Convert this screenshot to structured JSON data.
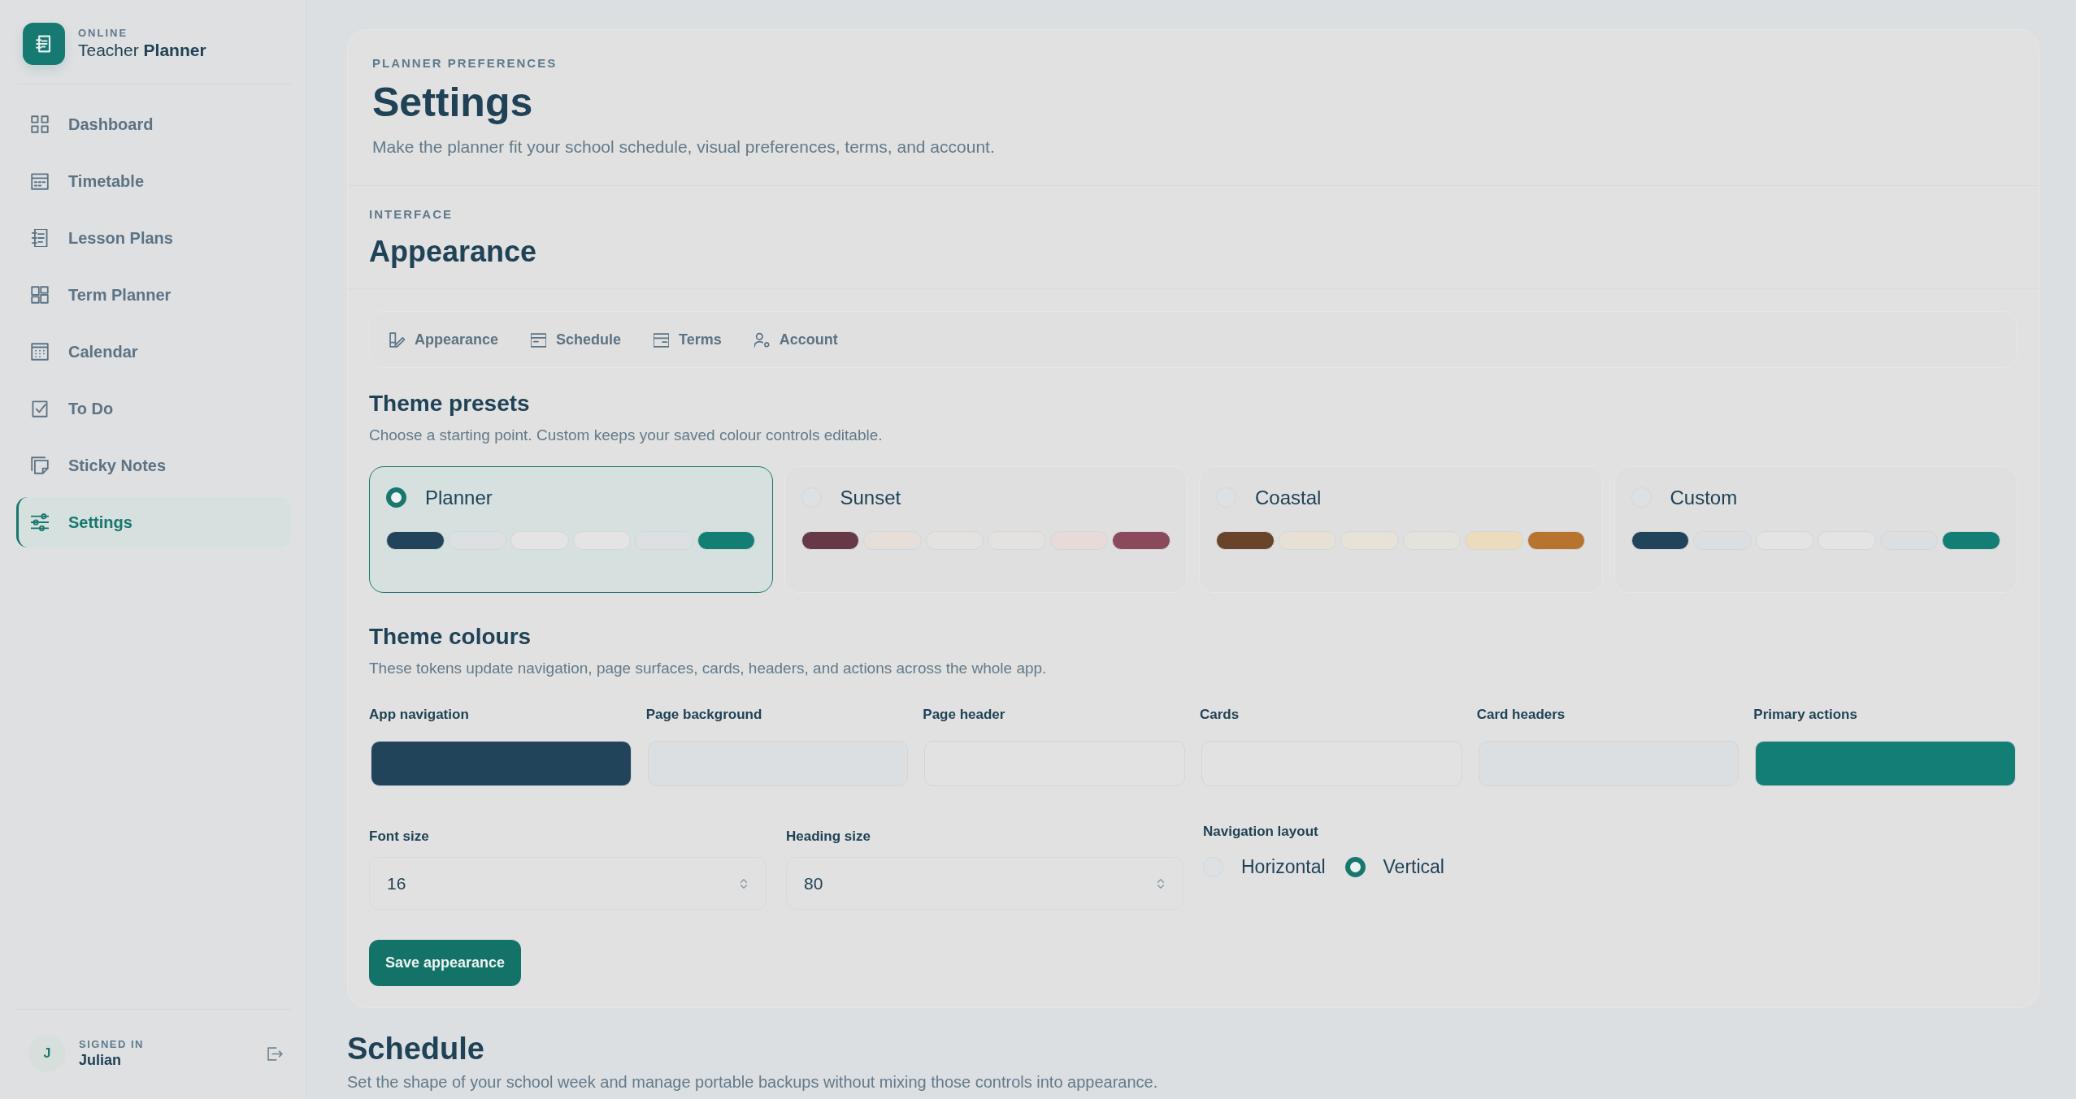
{
  "sidebar": {
    "brand": {
      "eyebrow": "ONLINE",
      "name": "Teacher **Planner**"
    },
    "nav": [
      {
        "label": "Dashboard",
        "selected": false
      },
      {
        "label": "Timetable",
        "selected": false
      },
      {
        "label": "Lesson Plans",
        "selected": false
      },
      {
        "label": "Term Planner",
        "selected": false
      },
      {
        "label": "Calendar",
        "selected": false
      },
      {
        "label": "To Do",
        "selected": false
      },
      {
        "label": "Sticky Notes",
        "selected": false
      },
      {
        "label": "Settings",
        "selected": true
      }
    ],
    "user": {
      "initial": "J",
      "caption": "SIGNED IN",
      "name": "Julian"
    }
  },
  "page_header": {
    "eyebrow": "PLANNER PREFERENCES",
    "title": "Settings",
    "subtitle": "Make the planner fit your school schedule, visual preferences, terms, and account."
  },
  "section": {
    "eyebrow": "INTERFACE",
    "title": "Appearance"
  },
  "tabs": [
    {
      "label": "Appearance"
    },
    {
      "label": "Schedule"
    },
    {
      "label": "Terms"
    },
    {
      "label": "Account"
    }
  ],
  "theme_presets": {
    "title": "Theme presets",
    "description": "Choose a starting point. Custom keeps your saved colour controls editable.",
    "presets": [
      {
        "name": "Planner",
        "selected": true,
        "swatches": [
          {
            "color": "#21445a"
          },
          {
            "color": "#dce0e3"
          },
          {
            "color": "#e4e4e4"
          },
          {
            "color": "#e4e4e4"
          },
          {
            "color": "#dce0e3"
          },
          {
            "color": "#137f74"
          }
        ]
      },
      {
        "name": "Sunset",
        "selected": false,
        "swatches": [
          {
            "color": "#673846"
          },
          {
            "color": "#e5ded9"
          },
          {
            "color": "#e3e2e0"
          },
          {
            "color": "#e3e2e0"
          },
          {
            "color": "#e6dbd9"
          },
          {
            "color": "#8b4a5c"
          }
        ]
      },
      {
        "name": "Coastal",
        "selected": false,
        "swatches": [
          {
            "color": "#6a4428"
          },
          {
            "color": "#e7e1d5"
          },
          {
            "color": "#e7e2d7"
          },
          {
            "color": "#e4e2dd"
          },
          {
            "color": "#ecdcbd"
          },
          {
            "color": "#b6742f"
          }
        ]
      },
      {
        "name": "Custom",
        "selected": false,
        "swatches": [
          {
            "color": "#21445a"
          },
          {
            "color": "#dbdfe1"
          },
          {
            "color": "#e4e4e4"
          },
          {
            "color": "#e4e4e4"
          },
          {
            "color": "#dbdfe1"
          },
          {
            "color": "#137f74"
          }
        ]
      }
    ]
  },
  "theme_colours": {
    "title": "Theme colours",
    "description": "These tokens update navigation, page surfaces, cards, headers, and actions across the whole app.",
    "fields": [
      {
        "label": "App navigation",
        "color": "#21445a"
      },
      {
        "label": "Page background",
        "color": "#dbdfe1"
      },
      {
        "label": "Page header",
        "color": "#e2e2e2"
      },
      {
        "label": "Cards",
        "color": "#e2e2e2"
      },
      {
        "label": "Card headers",
        "color": "#dbdfe1"
      },
      {
        "label": "Primary actions",
        "color": "#137f74"
      }
    ]
  },
  "font_size": {
    "label": "Font size",
    "value": "16"
  },
  "heading_size": {
    "label": "Heading size",
    "value": "80"
  },
  "navigation_layout": {
    "label": "Navigation layout",
    "options": [
      {
        "label": "Horizontal",
        "selected": false
      },
      {
        "label": "Vertical",
        "selected": true
      }
    ]
  },
  "save_button": "Save appearance",
  "schedule": {
    "title": "Schedule",
    "description": "Set the shape of your school week and manage portable backups without mixing those controls into appearance."
  }
}
